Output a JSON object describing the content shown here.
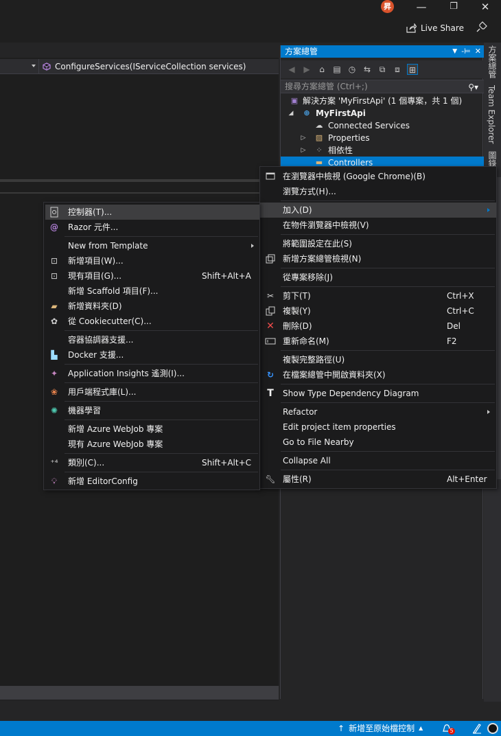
{
  "titlebar": {
    "avatar_initial": "昇",
    "minimize": "—",
    "restore": "❐",
    "close": "✕",
    "live_share": "Live Share"
  },
  "editor": {
    "member_dropdown": "ConfigureServices(IServiceCollection services)"
  },
  "solution_explorer": {
    "title": "方案總管",
    "header_controls": [
      "▼",
      "-⊨",
      "✕"
    ],
    "search_placeholder": "搜尋方案總管 (Ctrl+;)",
    "tree": [
      {
        "label": "解決方案 'MyFirstApi' (1 個專案，共 1 個)",
        "icon": "solution-icon"
      },
      {
        "label": "MyFirstApi",
        "icon": "web-project-icon",
        "expanded": true
      },
      {
        "label": "Connected Services",
        "icon": "connected-services-icon"
      },
      {
        "label": "Properties",
        "icon": "properties-icon"
      },
      {
        "label": "相依性",
        "icon": "dependencies-icon"
      },
      {
        "label": "Controllers",
        "icon": "folder-icon",
        "selected": true
      }
    ]
  },
  "side_tabs": [
    "方案總管",
    "Team Explorer",
    "圖錄"
  ],
  "context_menu": {
    "items": [
      {
        "label": "在瀏覽器中檢視 (Google Chrome)(B)",
        "icon": "browser-view-icon",
        "shortcut": ""
      },
      {
        "label": "瀏覽方式(H)...",
        "icon": "",
        "shortcut": ""
      },
      {
        "label": "加入(D)",
        "icon": "",
        "shortcut": "",
        "submenu": true,
        "highlighted": true
      },
      {
        "label": "在物件瀏覽器中檢視(V)",
        "icon": "",
        "shortcut": ""
      },
      {
        "label": "將範圍設定在此(S)",
        "icon": "",
        "shortcut": ""
      },
      {
        "label": "新增方案總管檢視(N)",
        "icon": "new-explorer-view-icon",
        "shortcut": ""
      },
      {
        "label": "從專案移除(J)",
        "icon": "",
        "shortcut": ""
      },
      {
        "label": "剪下(T)",
        "icon": "scissors-icon",
        "shortcut": "Ctrl+X"
      },
      {
        "label": "複製(Y)",
        "icon": "copy-icon",
        "shortcut": "Ctrl+C"
      },
      {
        "label": "刪除(D)",
        "icon": "delete-x-icon",
        "shortcut": "Del"
      },
      {
        "label": "重新命名(M)",
        "icon": "rename-icon",
        "shortcut": "F2"
      },
      {
        "label": "複製完整路徑(U)",
        "icon": "",
        "shortcut": ""
      },
      {
        "label": "在檔案總管中開啟資料夾(X)",
        "icon": "refresh-arrow-icon",
        "shortcut": ""
      },
      {
        "label": "Show Type Dependency Diagram",
        "icon": "type-diagram-icon",
        "shortcut": ""
      },
      {
        "label": "Refactor",
        "icon": "",
        "shortcut": "",
        "submenu": true
      },
      {
        "label": "Edit project item properties",
        "icon": "",
        "shortcut": ""
      },
      {
        "label": "Go to File Nearby",
        "icon": "",
        "shortcut": ""
      },
      {
        "label": "Collapse All",
        "icon": "",
        "shortcut": ""
      },
      {
        "label": "屬性(R)",
        "icon": "wrench-icon",
        "shortcut": "Alt+Enter"
      }
    ]
  },
  "add_submenu": {
    "items": [
      {
        "label": "控制器(T)...",
        "icon": "controller-icon",
        "shortcut": "",
        "highlighted": true
      },
      {
        "label": "Razor 元件...",
        "icon": "razor-icon",
        "shortcut": ""
      },
      {
        "label": "New from Template",
        "icon": "",
        "shortcut": "",
        "submenu": true
      },
      {
        "label": "新增項目(W)...",
        "icon": "new-item-icon",
        "shortcut": ""
      },
      {
        "label": "現有項目(G)...",
        "icon": "existing-item-icon",
        "shortcut": "Shift+Alt+A"
      },
      {
        "label": "新增 Scaffold 項目(F)...",
        "icon": "",
        "shortcut": ""
      },
      {
        "label": "新增資料夾(D)",
        "icon": "new-folder-icon",
        "shortcut": ""
      },
      {
        "label": "從 Cookiecutter(C)...",
        "icon": "cookiecutter-icon",
        "shortcut": ""
      },
      {
        "label": "容器協調器支援...",
        "icon": "",
        "shortcut": ""
      },
      {
        "label": "Docker 支援...",
        "icon": "docker-icon",
        "shortcut": ""
      },
      {
        "label": "Application Insights 遙測(I)...",
        "icon": "app-insights-icon",
        "shortcut": ""
      },
      {
        "label": "用戶端程式庫(L)...",
        "icon": "client-library-icon",
        "shortcut": ""
      },
      {
        "label": "機器學習",
        "icon": "machine-learning-icon",
        "shortcut": ""
      },
      {
        "label": "新增 Azure WebJob 專案",
        "icon": "",
        "shortcut": ""
      },
      {
        "label": "現有 Azure WebJob 專案",
        "icon": "",
        "shortcut": ""
      },
      {
        "label": "類別(C)...",
        "icon": "class-icon",
        "shortcut": "Shift+Alt+C"
      },
      {
        "label": "新增 EditorConfig",
        "icon": "editorconfig-icon",
        "shortcut": ""
      }
    ]
  },
  "statusbar": {
    "source_control": "新增至原始檔控制",
    "notification_count": "5"
  },
  "colors": {
    "accent": "#007acc",
    "menu_bg": "#1b1b1c",
    "menu_highlight": "#3e3e40",
    "editor_bg": "#1e1e1e"
  }
}
